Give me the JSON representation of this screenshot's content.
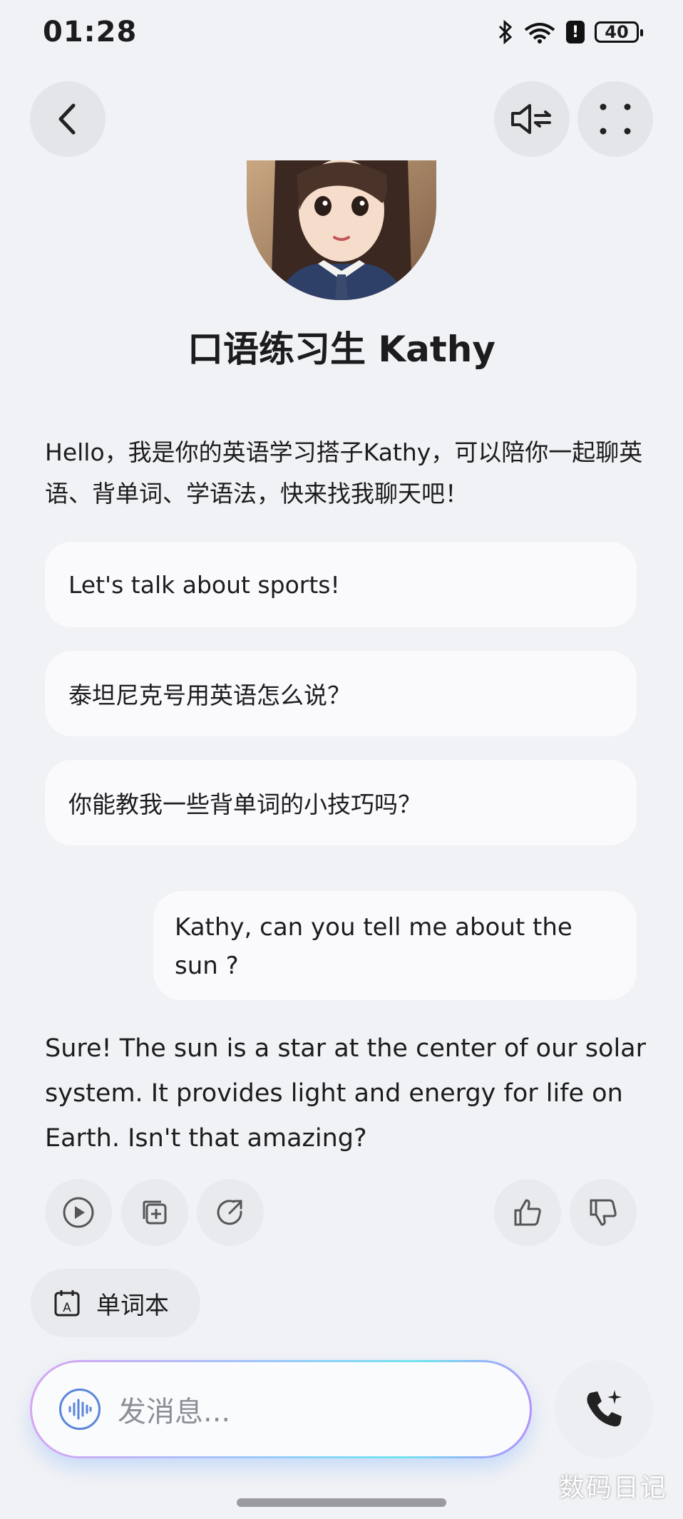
{
  "status_bar": {
    "time": "01:28",
    "battery": "40"
  },
  "bot": {
    "name": "口语练习生 Kathy"
  },
  "intro_message": "Hello，我是你的英语学习搭子Kathy，可以陪你一起聊英语、背单词、学语法，快来找我聊天吧！",
  "suggestions": [
    {
      "label": "Let's talk about sports!"
    },
    {
      "label": "泰坦尼克号用英语怎么说？"
    },
    {
      "label": "你能教我一些背单词的小技巧吗？"
    }
  ],
  "user_message": "Kathy, can you tell me about the sun ?",
  "bot_reply": "Sure! The sun is a star at the center of our solar system. It provides light and energy for life on Earth. Isn't that amazing?",
  "vocab_button": {
    "label": "单词本"
  },
  "composer": {
    "placeholder": "发消息..."
  },
  "watermark": "数码日记",
  "icons": {
    "back": "chevron-left-icon",
    "speaker": "speaker-settings-icon",
    "menu": "four-dots-icon",
    "play": "play-icon",
    "copy": "copy-add-icon",
    "share": "share-icon",
    "like": "thumbs-up-icon",
    "dislike": "thumbs-down-icon",
    "vocab": "calendar-a-icon",
    "voice": "waveform-icon",
    "call": "phone-sparkle-icon"
  },
  "colors": {
    "background": "#f1f2f5",
    "bubble": "#fafafc",
    "accent": "#5a86d9"
  }
}
